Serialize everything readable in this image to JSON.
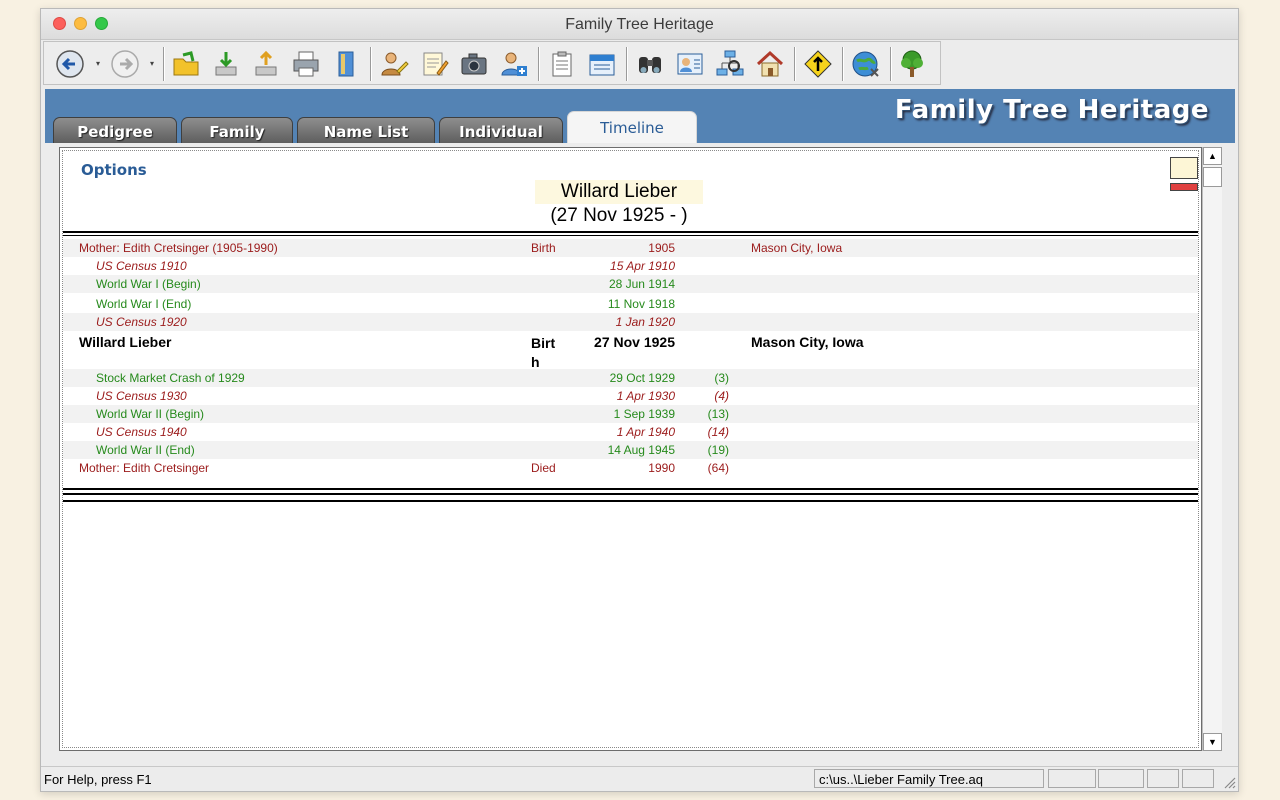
{
  "window": {
    "title": "Family Tree Heritage"
  },
  "toolbar": {
    "buttons": [
      {
        "icon": "back-arrow-icon"
      },
      {
        "icon": "forward-arrow-icon"
      },
      {
        "icon": "open-folder-icon"
      },
      {
        "icon": "import-icon"
      },
      {
        "icon": "export-icon"
      },
      {
        "icon": "print-icon"
      },
      {
        "icon": "book-icon"
      },
      {
        "icon": "edit-person-icon"
      },
      {
        "icon": "notepad-icon"
      },
      {
        "icon": "camera-icon"
      },
      {
        "icon": "add-person-icon"
      },
      {
        "icon": "clipboard-icon"
      },
      {
        "icon": "calendar-icon"
      },
      {
        "icon": "binoculars-icon"
      },
      {
        "icon": "person-card-icon"
      },
      {
        "icon": "tree-chart-icon"
      },
      {
        "icon": "home-icon"
      },
      {
        "icon": "relationship-sign-icon"
      },
      {
        "icon": "web-globe-icon"
      },
      {
        "icon": "tree-icon"
      }
    ]
  },
  "banner": {
    "title": "Family Tree Heritage"
  },
  "tabs": [
    {
      "label": "Pedigree"
    },
    {
      "label": "Family"
    },
    {
      "label": "Name List"
    },
    {
      "label": "Individual"
    },
    {
      "label": "Timeline",
      "active": true
    }
  ],
  "timeline": {
    "options_label": "Options",
    "person_name": "Willard Lieber",
    "person_dates": "(27 Nov 1925 - )",
    "rows": [
      {
        "event": "Mother: Edith Cretsinger (1905-1990)",
        "type": "Birth",
        "date": "1905",
        "age": "",
        "place": "Mason City, Iowa",
        "style": "red",
        "indent": false
      },
      {
        "event": "US Census 1910",
        "type": "",
        "date": "15 Apr 1910",
        "age": "",
        "place": "",
        "style": "red-italic",
        "indent": true
      },
      {
        "event": "World War I (Begin)",
        "type": "",
        "date": "28 Jun 1914",
        "age": "",
        "place": "",
        "style": "green",
        "indent": true
      },
      {
        "event": "World War I (End)",
        "type": "",
        "date": "11 Nov 1918",
        "age": "",
        "place": "",
        "style": "green",
        "indent": true
      },
      {
        "event": "US Census 1920",
        "type": "",
        "date": "1 Jan 1920",
        "age": "",
        "place": "",
        "style": "red-italic",
        "indent": true
      },
      {
        "event": "Willard Lieber",
        "type": "Birth",
        "date": "27 Nov 1925",
        "age": "",
        "place": "Mason City, Iowa",
        "style": "main",
        "indent": false
      },
      {
        "event": "Stock Market Crash of 1929",
        "type": "",
        "date": "29 Oct 1929",
        "age": "(3)",
        "place": "",
        "style": "green",
        "indent": true
      },
      {
        "event": "US Census 1930",
        "type": "",
        "date": "1 Apr 1930",
        "age": "(4)",
        "place": "",
        "style": "red-italic",
        "indent": true
      },
      {
        "event": "World War II (Begin)",
        "type": "",
        "date": "1 Sep 1939",
        "age": "(13)",
        "place": "",
        "style": "green",
        "indent": true
      },
      {
        "event": "US Census 1940",
        "type": "",
        "date": "1 Apr 1940",
        "age": "(14)",
        "place": "",
        "style": "red-italic",
        "indent": true
      },
      {
        "event": "World War II (End)",
        "type": "",
        "date": "14 Aug 1945",
        "age": "(19)",
        "place": "",
        "style": "green",
        "indent": true
      },
      {
        "event": "Mother: Edith Cretsinger",
        "type": "Died",
        "date": "1990",
        "age": "(64)",
        "place": "",
        "style": "red",
        "indent": false
      }
    ]
  },
  "statusbar": {
    "help": "For Help, press F1",
    "path": "c:\\us..\\Lieber Family Tree.aq"
  },
  "colors": {
    "banner": "#5483b4",
    "accent_blue": "#2a5c96",
    "event_red": "#9b1b1b",
    "event_green": "#268a1c"
  }
}
